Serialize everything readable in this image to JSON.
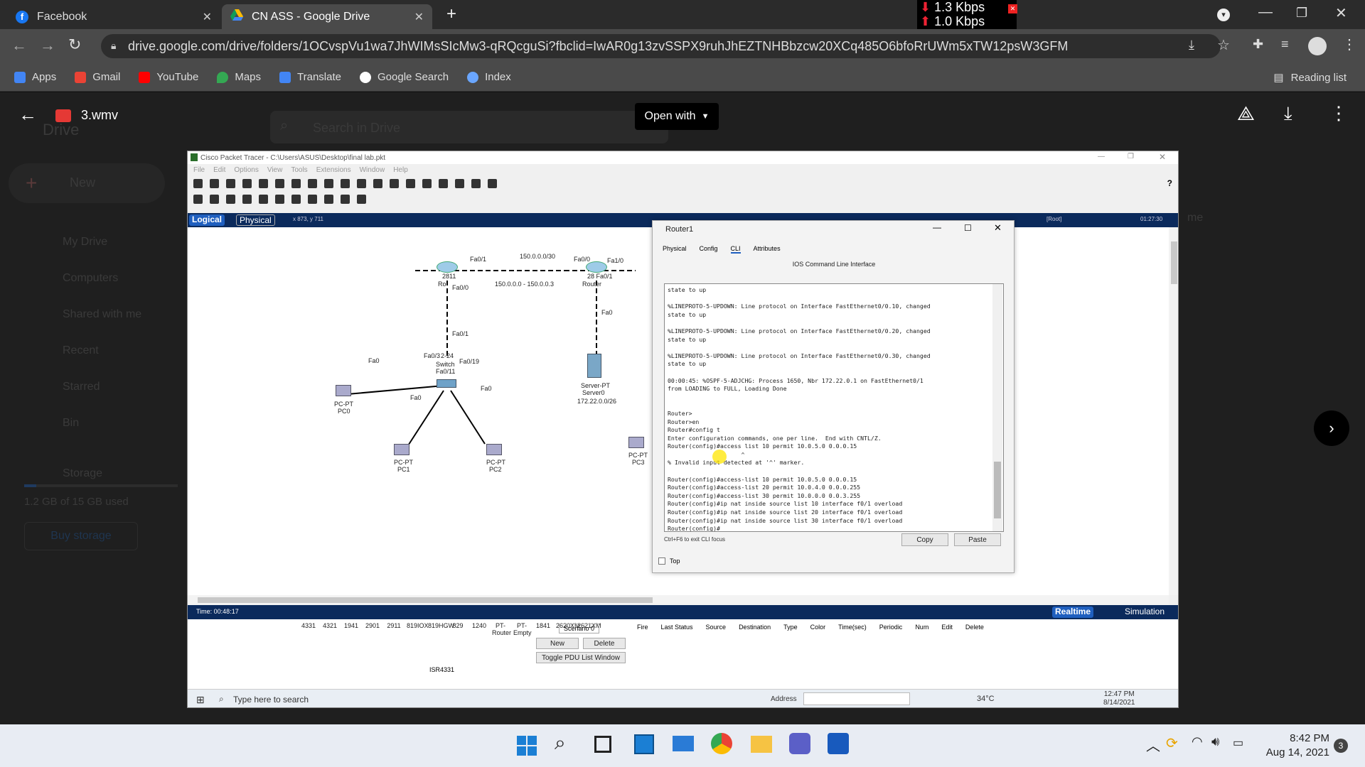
{
  "tabs": [
    {
      "label": "Facebook"
    },
    {
      "label": "CN ASS - Google Drive"
    }
  ],
  "net_speed": {
    "down": "1.3 Kbps",
    "up": "1.0 Kbps"
  },
  "address": "drive.google.com/drive/folders/1OCvspVu1wa7JhWIMsSIcMw3-qRQcguSi?fbclid=IwAR0g13zvSSPX9ruhJhEZTNHBbzcw20XCq485O6bfoRrUWm5xTW12psW3GFM",
  "bookmarks": [
    {
      "label": "Apps",
      "color": "#4285f4"
    },
    {
      "label": "Gmail",
      "color": "#ea4335"
    },
    {
      "label": "YouTube",
      "color": "#ff0000"
    },
    {
      "label": "Maps",
      "color": "#34a853"
    },
    {
      "label": "Translate",
      "color": "#4285f4"
    },
    {
      "label": "Google Search",
      "color": "#ffffff"
    },
    {
      "label": "Index",
      "color": "#6aa6ff"
    }
  ],
  "reading_list": "Reading list",
  "viewer": {
    "file_name": "3.wmv",
    "open_with": "Open with",
    "search_placeholder": "Search in Drive",
    "drive_label": "Drive"
  },
  "drive_side": {
    "new": "New",
    "items": [
      "My Drive",
      "Computers",
      "Shared with me",
      "Recent",
      "Starred",
      "Bin",
      "Storage"
    ],
    "storage_used": "1.2 GB of 15 GB used",
    "buy": "Buy storage",
    "me_label": "me"
  },
  "pt": {
    "title": "Cisco Packet Tracer - C:\\Users\\ASUS\\Desktop\\final lab.pkt",
    "menu": [
      "File",
      "Edit",
      "Options",
      "View",
      "Tools",
      "Extensions",
      "Window",
      "Help"
    ],
    "logical": "Logical",
    "physical": "Physical",
    "coords": "x 873, y 711",
    "root": "[Root]",
    "clock": "01:27:30",
    "time": "Time: 00:48:17",
    "realtime": "Realtime",
    "simulation": "Simulation",
    "devices": {
      "r0": "2811",
      "r0b": "Ro",
      "r0fa": "Fa0/0",
      "r0fa1": "Fa0/1",
      "link_net": "150.0.0.0/30",
      "r1fa0": "Fa0/0",
      "r1fa1": "Fa1/0",
      "r1": "28 Fa0/1",
      "r1b": "Router",
      "range": "150.0.0.0 - 150.0.0.3",
      "srv_fa": "Fa0",
      "srv1": "Server-PT",
      "srv2": "Server0",
      "srv3": "172.22.0.0/26",
      "sw_fa1": "Fa0/1",
      "sw_fa3": "Fa0/3",
      "sw1": "Switch",
      "sw_fa11": "Fa0/11",
      "sw_fa19": "Fa0/19",
      "sw_model": "2-24",
      "pc0_fa": "Fa0",
      "pc0a": "PC-PT",
      "pc0b": "PC0",
      "pc1_fa": "Fa0",
      "pc1a": "PC-PT",
      "pc1b": "PC1",
      "pc2_fa": "Fa0",
      "pc2a": "PC-PT",
      "pc2b": "PC2",
      "pc3a": "PC-PT",
      "pc3b": "PC3"
    },
    "dialog": {
      "title": "Router1",
      "tabs": [
        "Physical",
        "Config",
        "CLI",
        "Attributes"
      ],
      "header": "IOS Command Line Interface",
      "cli": "state to up\n\n%LINEPROTO-5-UPDOWN: Line protocol on Interface FastEthernet0/0.10, changed\nstate to up\n\n%LINEPROTO-5-UPDOWN: Line protocol on Interface FastEthernet0/0.20, changed\nstate to up\n\n%LINEPROTO-5-UPDOWN: Line protocol on Interface FastEthernet0/0.30, changed\nstate to up\n\n00:00:45: %OSPF-5-ADJCHG: Process 1650, Nbr 172.22.0.1 on FastEthernet0/1\nfrom LOADING to FULL, Loading Done\n\n\nRouter>\nRouter>en\nRouter#config t\nEnter configuration commands, one per line.  End with CNTL/Z.\nRouter(config)#access list 10 permit 10.0.5.0 0.0.0.15\n                     ^\n% Invalid input detected at '^' marker.\n\nRouter(config)#access-list 10 permit 10.0.5.0 0.0.0.15\nRouter(config)#access-list 20 permit 10.0.4.0 0.0.0.255\nRouter(config)#access-list 30 permit 10.0.0.0 0.0.3.255\nRouter(config)#ip nat inside source list 10 interface f0/1 overload\nRouter(config)#ip nat inside source list 20 interface f0/1 overload\nRouter(config)#ip nat inside source list 30 interface f0/1 overload\nRouter(config)#",
      "hint": "Ctrl+F6 to exit CLI focus",
      "copy": "Copy",
      "paste": "Paste",
      "top": "Top"
    },
    "bottom": {
      "scenario": "Scenario 0",
      "new": "New",
      "delete": "Delete",
      "toggle": "Toggle PDU List Window",
      "model": "ISR4331",
      "models": [
        "4331",
        "4321",
        "1941",
        "2901",
        "2911",
        "819IOX",
        "819HGW",
        "829",
        "1240",
        "PT-Router",
        "PT-Empty",
        "1841",
        "2620XM",
        "2621XM"
      ],
      "cols": [
        "Fire",
        "Last Status",
        "Source",
        "Destination",
        "Type",
        "Color",
        "Time(sec)",
        "Periodic",
        "Num",
        "Edit",
        "Delete"
      ]
    },
    "taskbar": {
      "search": "Type here to search",
      "address": "Address",
      "temp": "34°C",
      "time": "12:47 PM",
      "date": "8/14/2021"
    }
  },
  "host": {
    "time": "8:42 PM",
    "date": "Aug 14, 2021",
    "badge": "3"
  }
}
